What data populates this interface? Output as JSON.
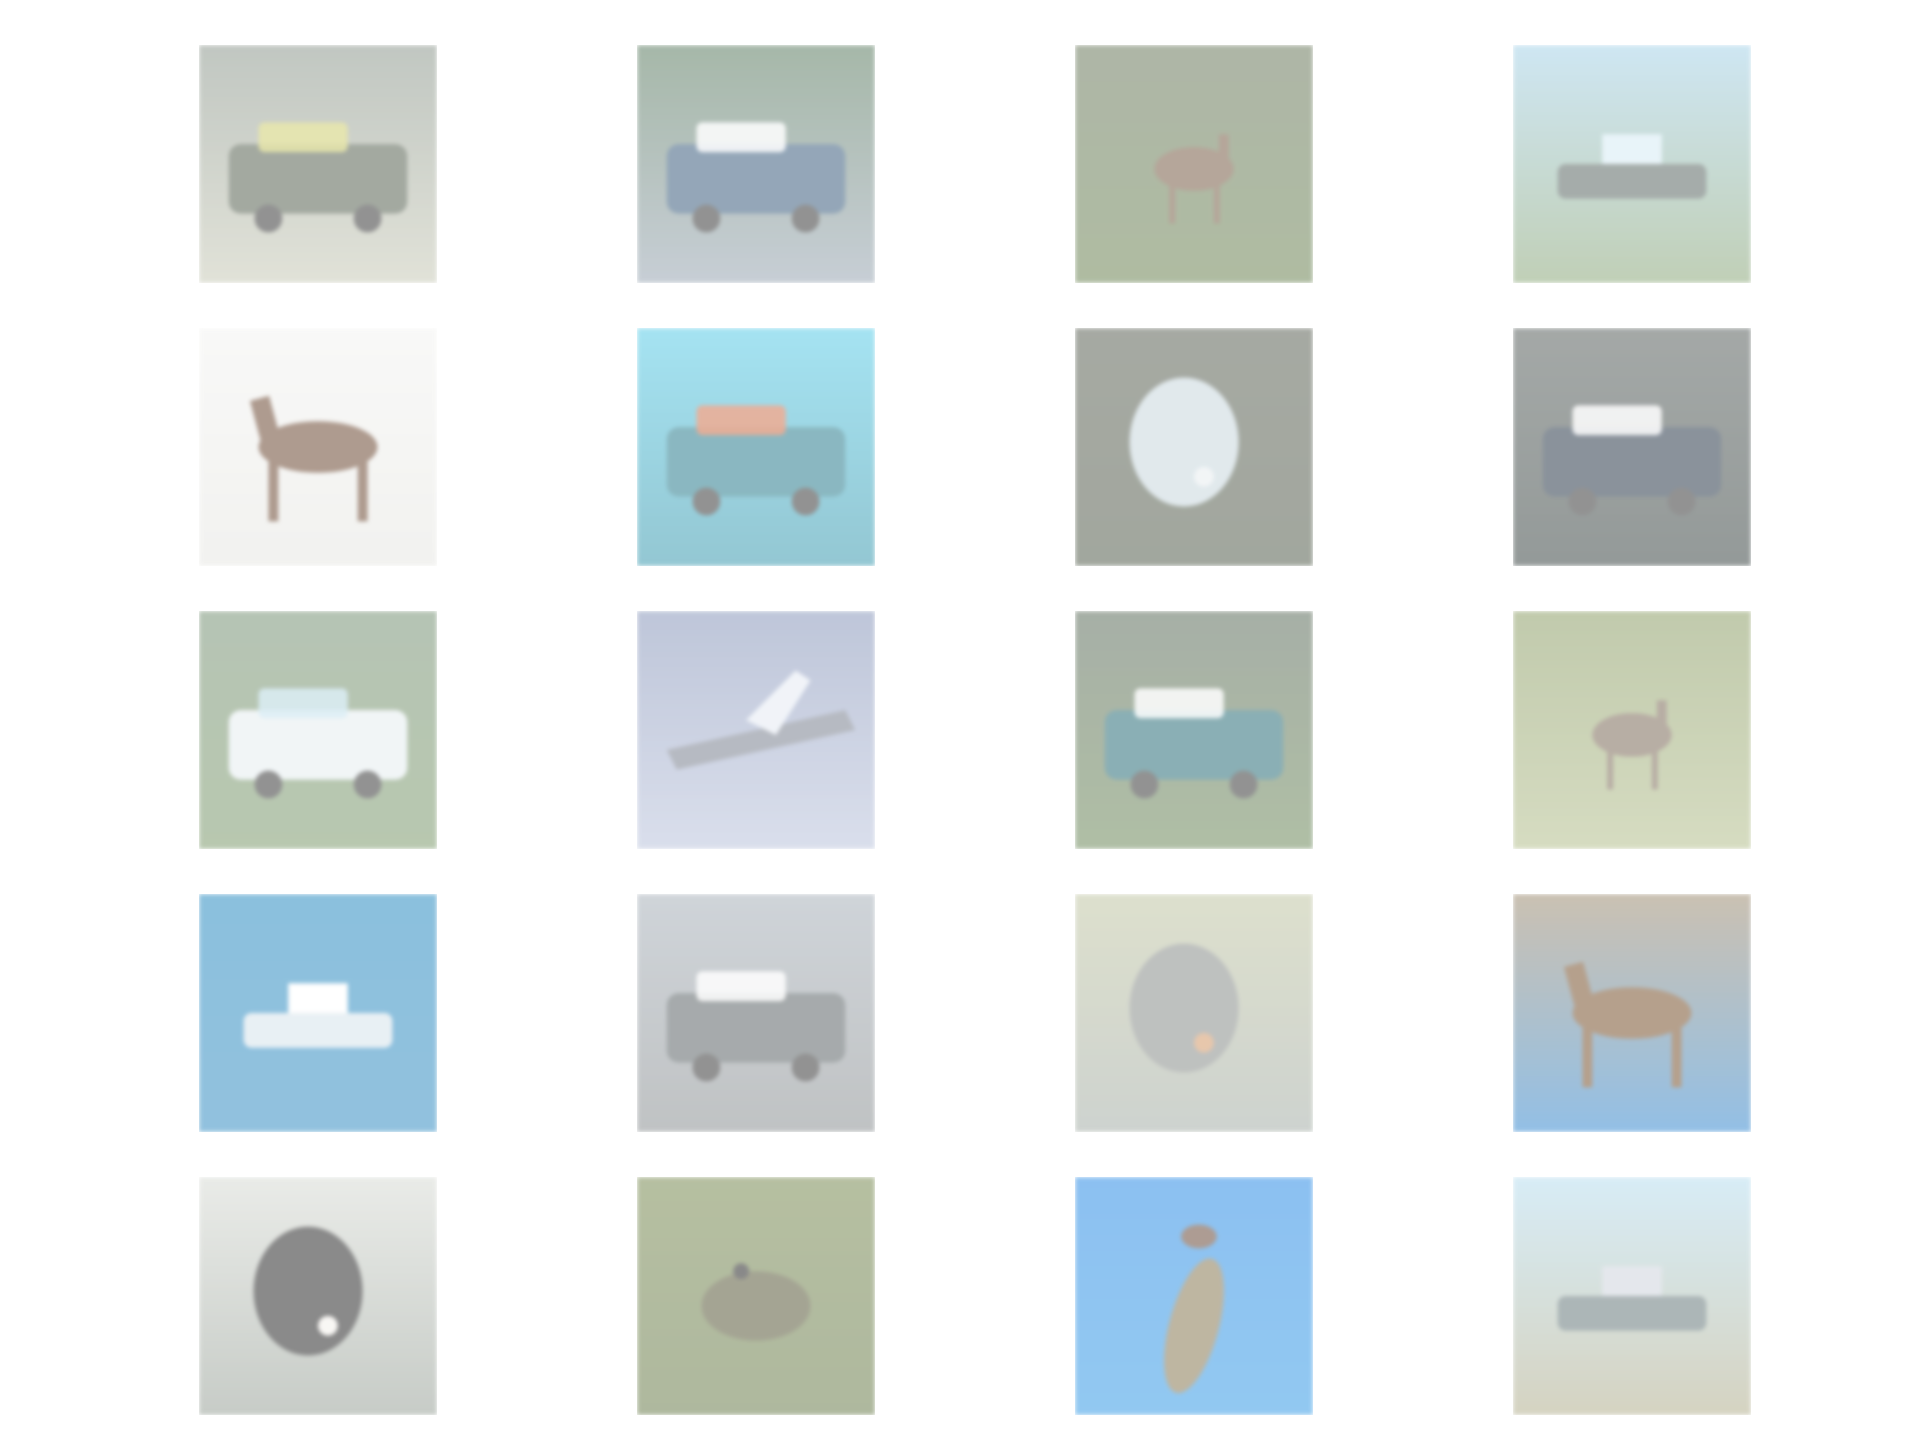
{
  "grid": {
    "rows": 5,
    "columns": 4,
    "tiles": [
      {
        "subject": "truck",
        "bg_top": "#8f9a90",
        "bg_bottom": "#c9cbb9",
        "accent": "#d6d36a",
        "subject_color": "#596454"
      },
      {
        "subject": "car",
        "bg_top": "#5e7e63",
        "bg_bottom": "#9aa7b4",
        "accent": "#ffffff",
        "subject_color": "#3d5f7f"
      },
      {
        "subject": "deer",
        "bg_top": "#6d7b5f",
        "bg_bottom": "#6e8656",
        "accent": "#95ad6d",
        "subject_color": "#7a5e48"
      },
      {
        "subject": "ship",
        "bg_top": "#a8d3e9",
        "bg_bottom": "#8ea97c",
        "accent": "#d7ecf5",
        "subject_color": "#5d6a66"
      },
      {
        "subject": "horse",
        "bg_top": "#f4f4f2",
        "bg_bottom": "#e8e8e4",
        "accent": "#d4d4d0",
        "subject_color": "#6d4a34"
      },
      {
        "subject": "truck",
        "bg_top": "#5ccde8",
        "bg_bottom": "#3c9aaf",
        "accent": "#e36a3c",
        "subject_color": "#2c7e8f"
      },
      {
        "subject": "cat",
        "bg_top": "#5e6458",
        "bg_bottom": "#56604f",
        "accent": "#e9eef0",
        "subject_color": "#c9d8de"
      },
      {
        "subject": "truck",
        "bg_top": "#5b6360",
        "bg_bottom": "#3d4846",
        "accent": "#ffffff",
        "subject_color": "#2b3a4b"
      },
      {
        "subject": "truck",
        "bg_top": "#7a9478",
        "bg_bottom": "#7f9c6f",
        "accent": "#bfe0ee",
        "subject_color": "#e6eef0"
      },
      {
        "subject": "airplane",
        "bg_top": "#8a98bb",
        "bg_bottom": "#bcc5dd",
        "accent": "#e6ebf4",
        "subject_color": "#7c8391"
      },
      {
        "subject": "truck",
        "bg_top": "#5f6f5e",
        "bg_bottom": "#6f8b5d",
        "accent": "#ffffff",
        "subject_color": "#2c6f79"
      },
      {
        "subject": "deer",
        "bg_top": "#8fa06a",
        "bg_bottom": "#b5c08f",
        "accent": "#e5c79a",
        "subject_color": "#7e6c5b"
      },
      {
        "subject": "ship",
        "bg_top": "#2d8ec2",
        "bg_bottom": "#3a90c4",
        "accent": "#ffffff",
        "subject_color": "#d7e4ec"
      },
      {
        "subject": "truck",
        "bg_top": "#a9b2bb",
        "bg_bottom": "#8d9294",
        "accent": "#ffffff",
        "subject_color": "#5e6669"
      },
      {
        "subject": "dog",
        "bg_top": "#c2c7a5",
        "bg_bottom": "#a6afa8",
        "accent": "#d49a6a",
        "subject_color": "#8a8f8c"
      },
      {
        "subject": "horse",
        "bg_top": "#a08f74",
        "bg_bottom": "#3b8cd1",
        "accent": "#4aa0e3",
        "subject_color": "#7a5430"
      },
      {
        "subject": "dog",
        "bg_top": "#d9dcd6",
        "bg_bottom": "#9aa39a",
        "accent": "#f4f1ec",
        "subject_color": "#2b2b2b"
      },
      {
        "subject": "frog",
        "bg_top": "#7b8c55",
        "bg_bottom": "#6d7f4f",
        "accent": "#c6a36a",
        "subject_color": "#5b5b3c"
      },
      {
        "subject": "bird",
        "bg_top": "#2f8ee6",
        "bg_bottom": "#3a9de6",
        "accent": "#d6e6f2",
        "subject_color": "#8a7b56"
      },
      {
        "subject": "ship",
        "bg_top": "#b8def0",
        "bg_bottom": "#b4b08f",
        "accent": "#cfd5de",
        "subject_color": "#6a7c7e"
      }
    ]
  }
}
